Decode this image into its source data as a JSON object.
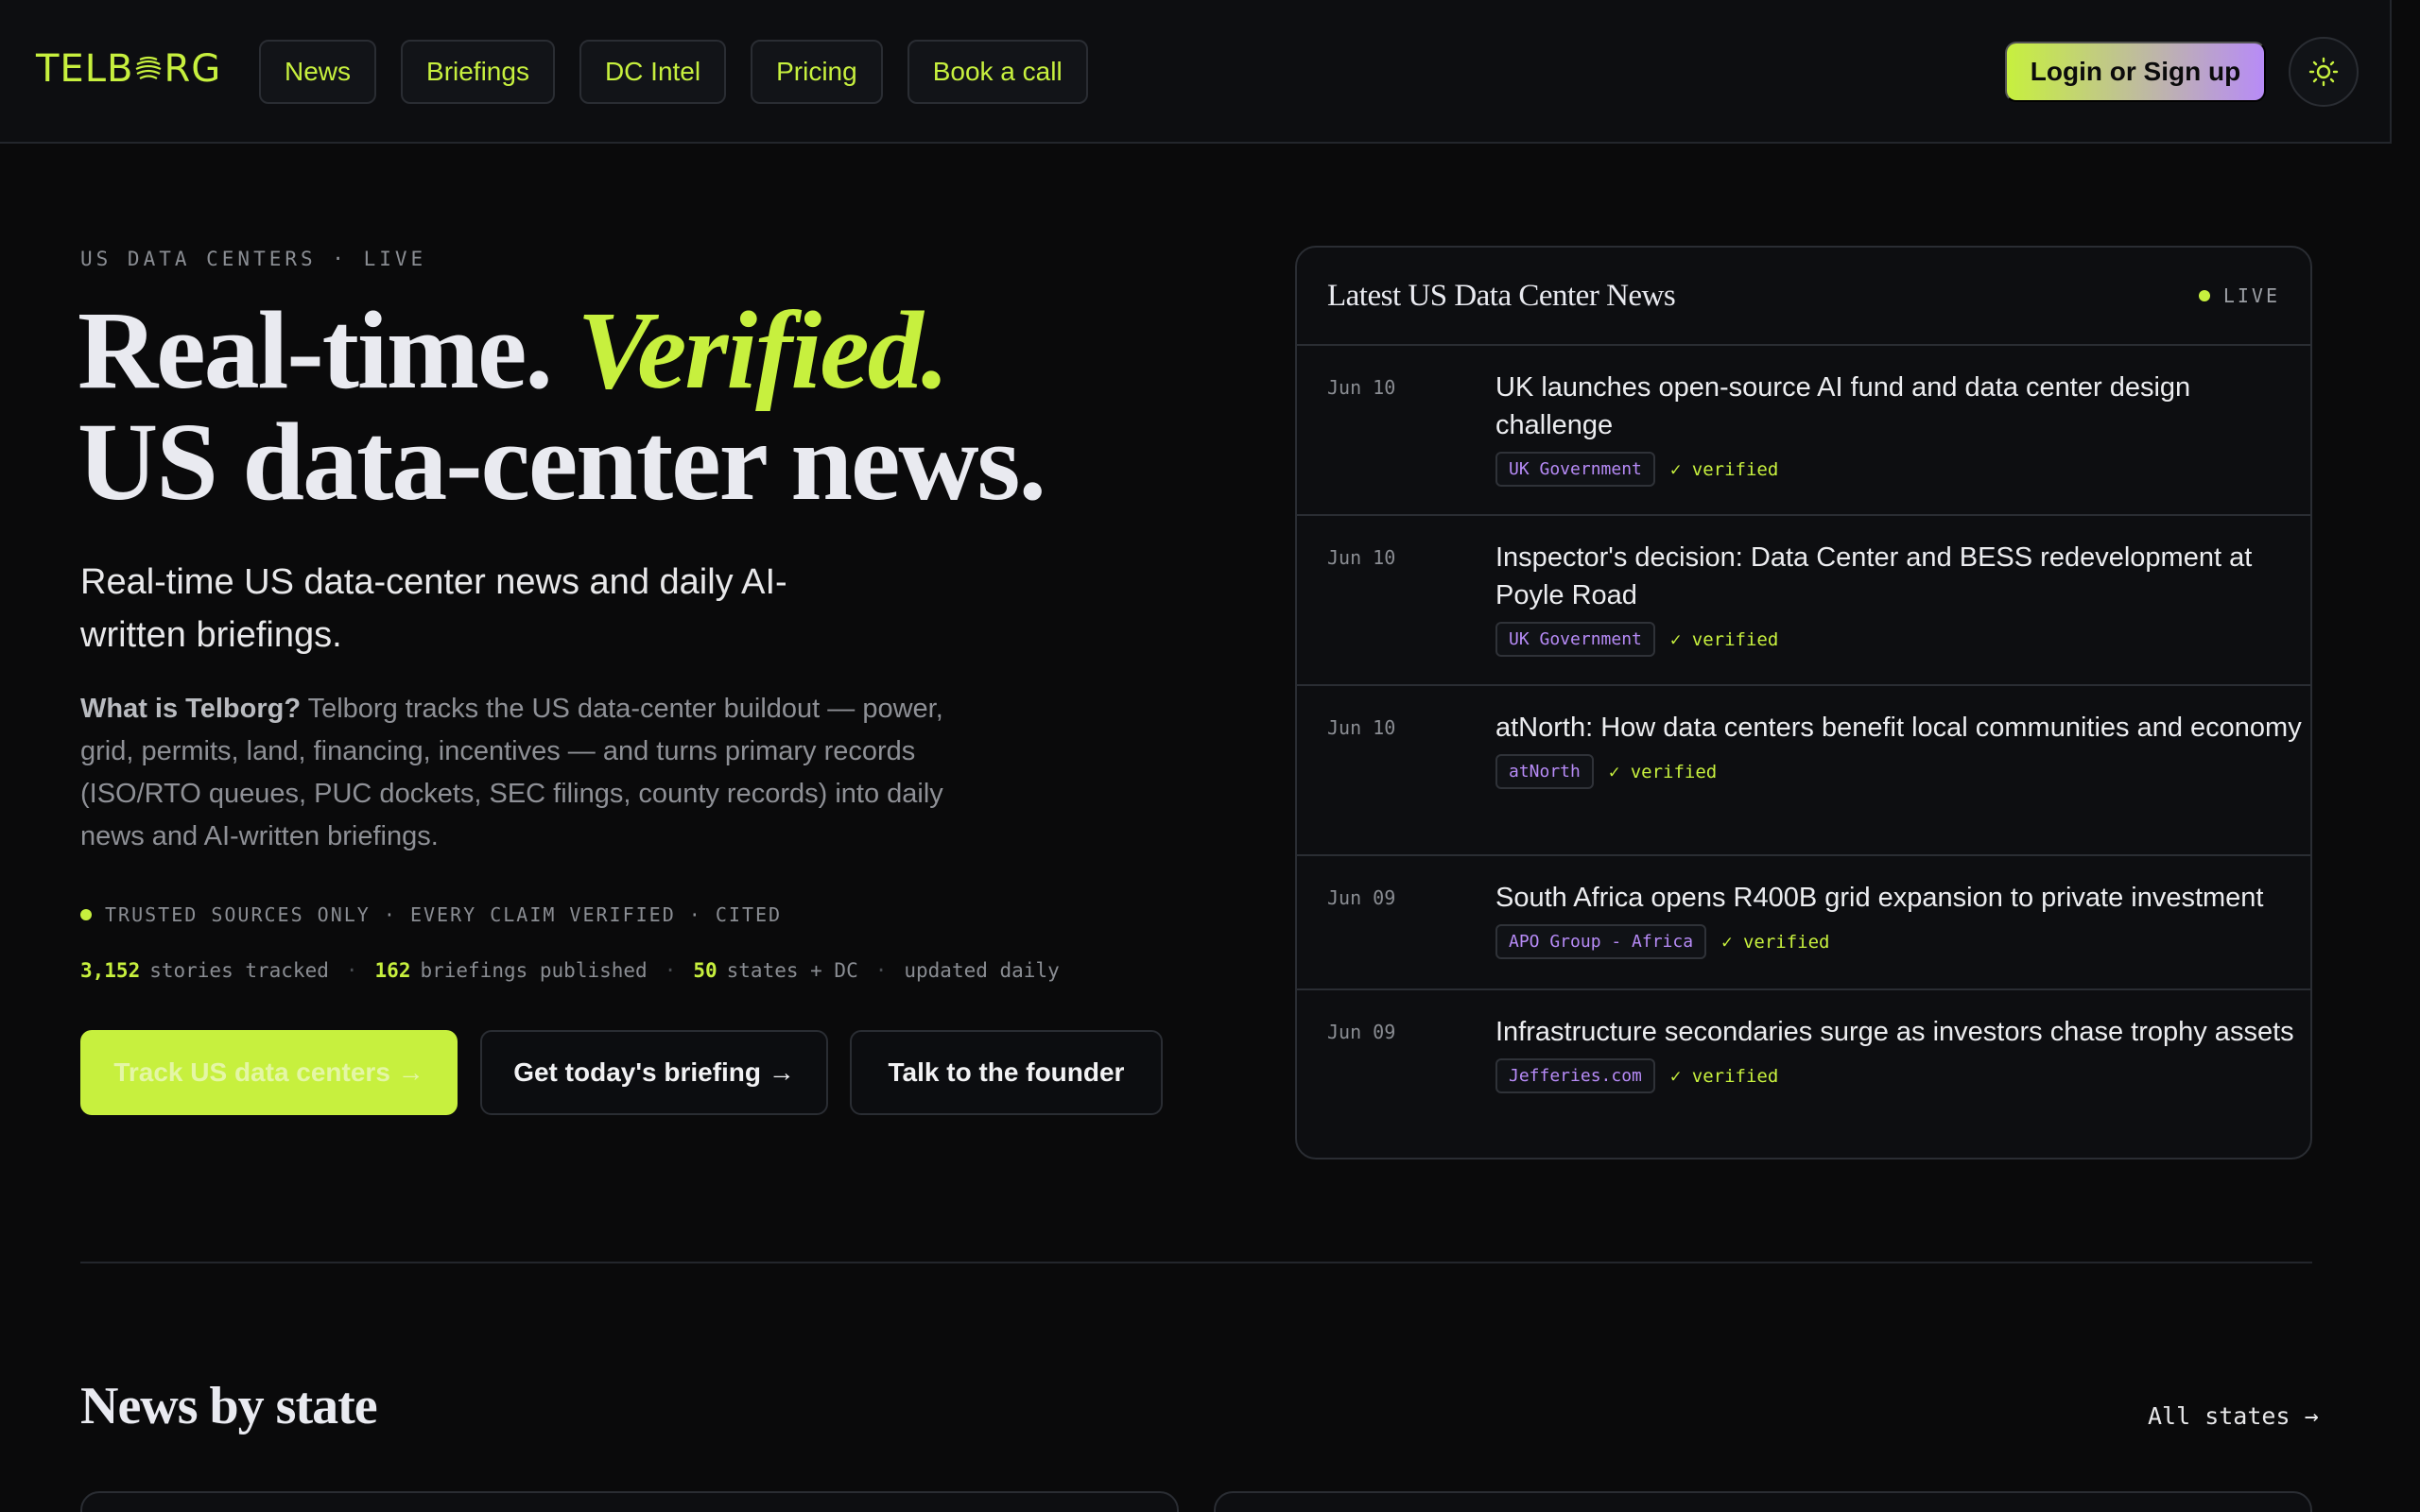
{
  "header": {
    "logo_text": "TELBORG",
    "nav": [
      "News",
      "Briefings",
      "DC Intel",
      "Pricing",
      "Book a call"
    ],
    "login_label": "Login or Sign up",
    "theme_icon": "sun-icon"
  },
  "hero": {
    "eyebrow": "US DATA CENTERS · LIVE",
    "headline_1": "Real-time.",
    "headline_accent": "Verified.",
    "headline_2": "US data-center news.",
    "subhead": "Real-time US data-center news and daily AI-written briefings.",
    "desc_bold": "What is Telborg?",
    "desc_text": " Telborg tracks the US data-center buildout — power, grid, permits, land, financing, incentives — and turns primary records (ISO/RTO queues, PUC dockets, SEC filings, county records) into daily news and AI-written briefings.",
    "trust": "TRUSTED SOURCES ONLY · EVERY CLAIM VERIFIED · CITED",
    "stats": {
      "stories_num": "3,152",
      "stories_label": "stories tracked",
      "briefings_num": "162",
      "briefings_label": "briefings published",
      "states_num": "50",
      "states_label": "states + DC",
      "updated": "updated daily",
      "sep": "·"
    },
    "cta_primary": "Track US data centers →",
    "cta_briefing": "Get today's briefing →",
    "cta_founder": "Talk to the founder"
  },
  "news_panel": {
    "title": "Latest US Data Center News",
    "live_label": "LIVE",
    "items": [
      {
        "date": "Jun 10",
        "title": "UK launches open-source AI fund and data center design challenge",
        "source": "UK Government",
        "status": "✓ verified"
      },
      {
        "date": "Jun 10",
        "title": "Inspector's decision: Data Center and BESS redevelopment at Poyle Road",
        "source": "UK Government",
        "status": "✓ verified"
      },
      {
        "date": "Jun 10",
        "title": "atNorth: How data centers benefit local communities and economy",
        "source": "atNorth",
        "status": "✓ verified"
      },
      {
        "date": "Jun 09",
        "title": "South Africa opens R400B grid expansion to private investment",
        "source": "APO Group - Africa",
        "status": "✓ verified"
      },
      {
        "date": "Jun 09",
        "title": "Infrastructure secondaries surge as investors chase trophy assets",
        "source": "Jefferies.com",
        "status": "✓ verified"
      }
    ]
  },
  "states_section": {
    "title": "News by state",
    "all_link": "All states →"
  },
  "colors": {
    "accent": "#c7f03e",
    "purple": "#b78bf7",
    "background": "#0a0a0b",
    "progress": "#2b9be3"
  }
}
